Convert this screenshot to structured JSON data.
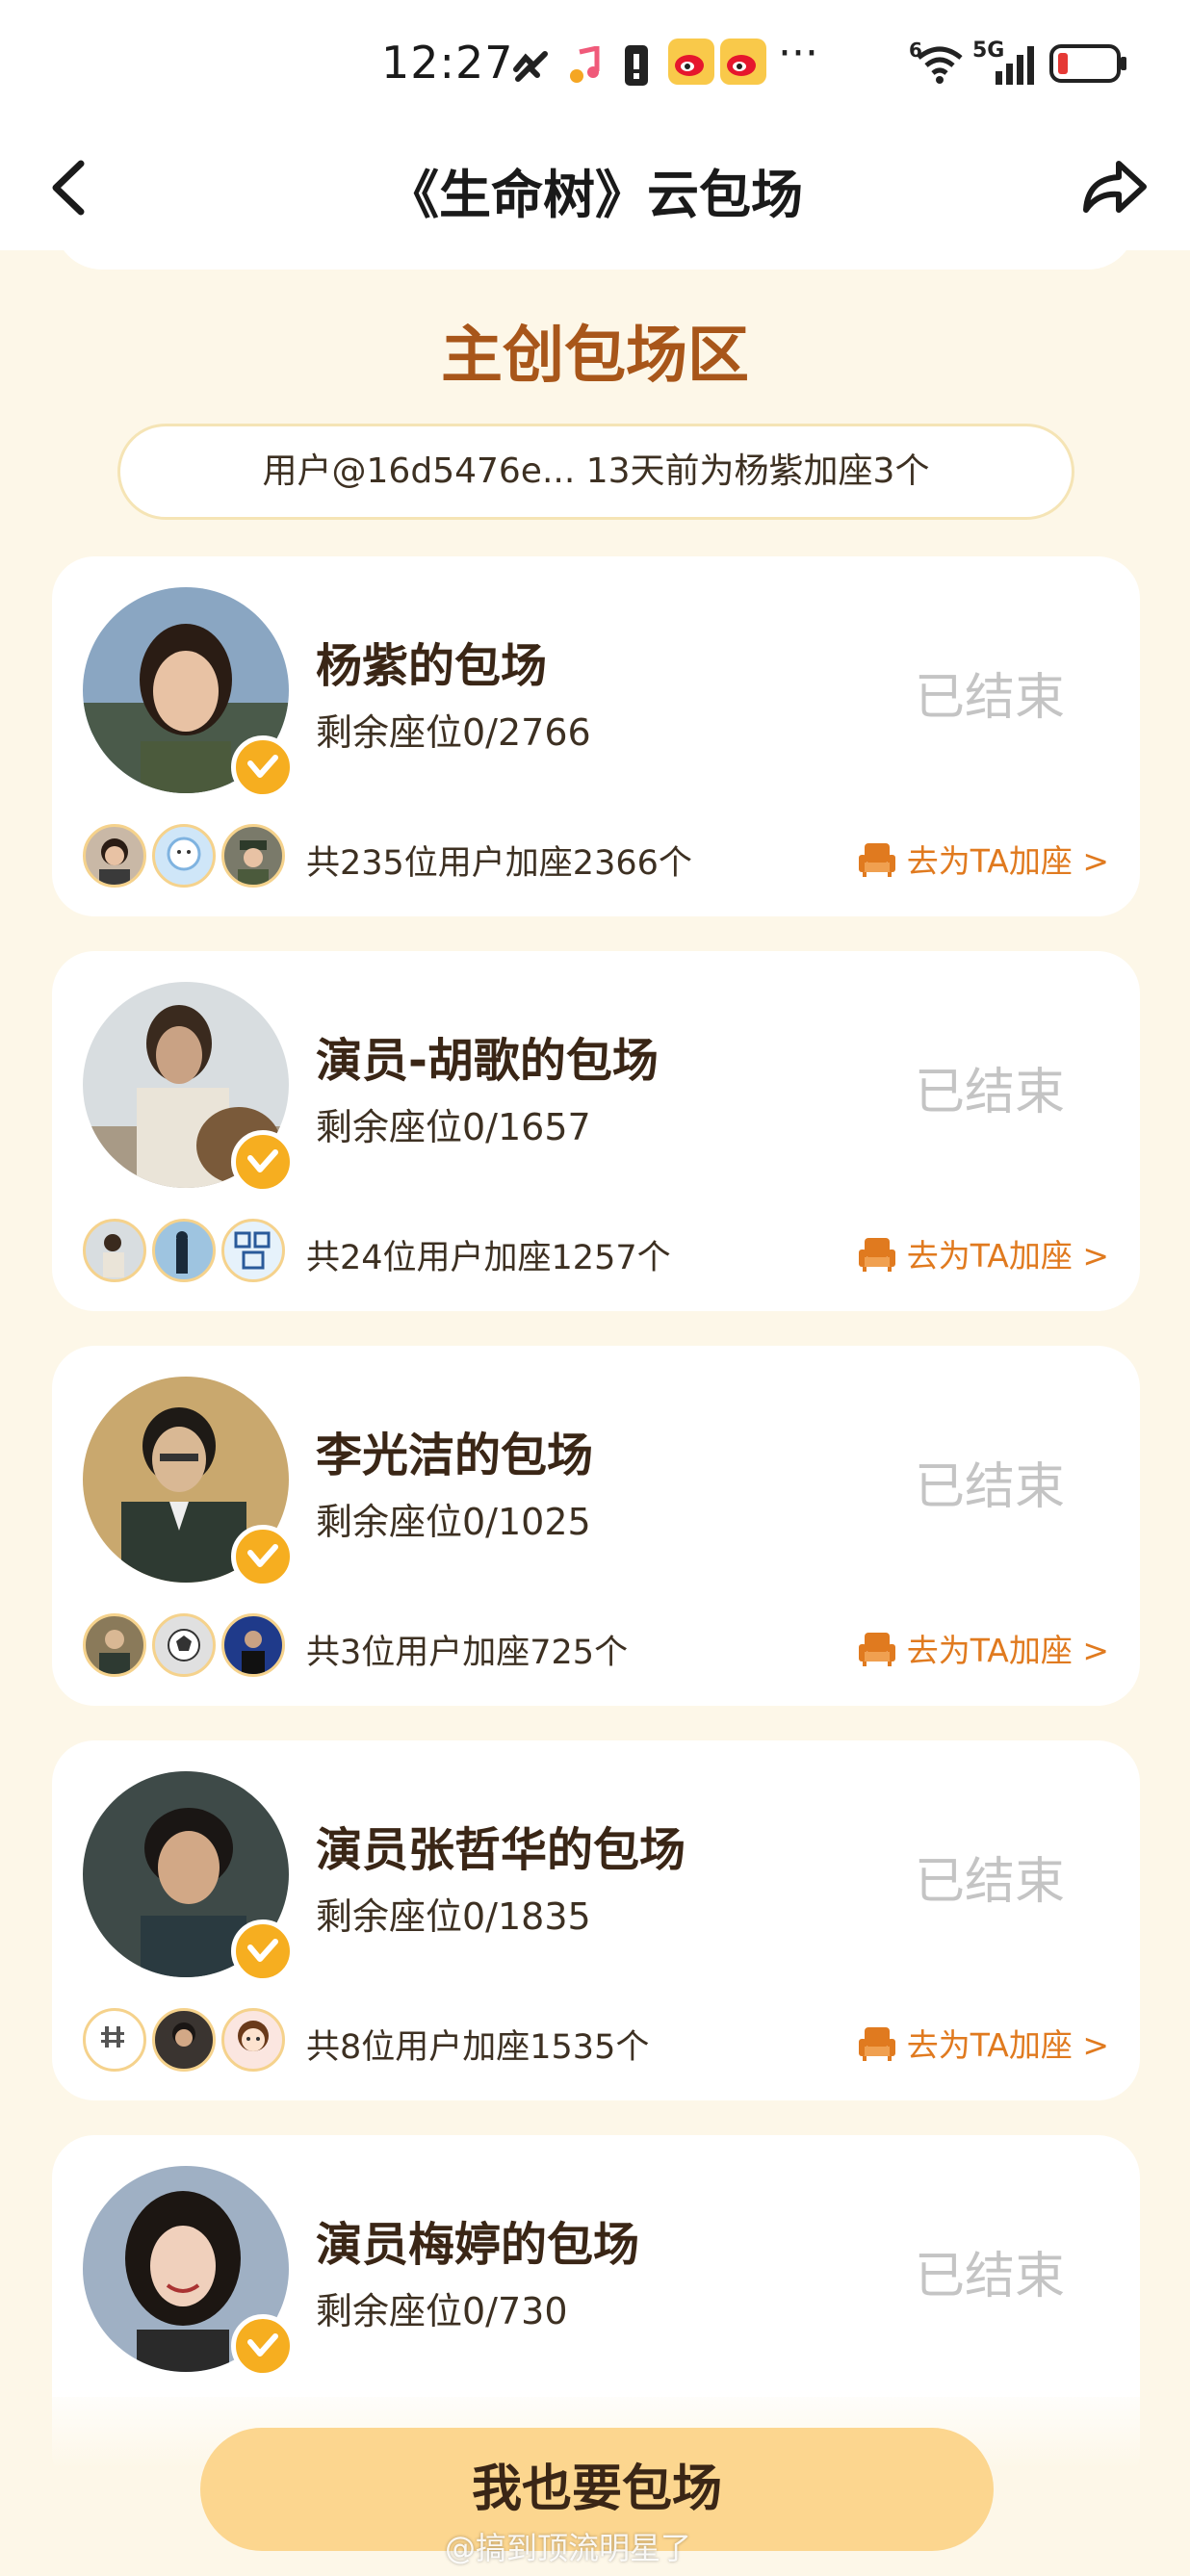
{
  "status_bar": {
    "time": "12:27",
    "more": "···",
    "network": "5G",
    "wifi_badge": "6"
  },
  "nav": {
    "title": "《生命树》云包场"
  },
  "section": {
    "title": "主创包场区",
    "notice": "用户@16d5476e... 13天前为杨紫加座3个"
  },
  "cards": [
    {
      "name": "杨紫的包场",
      "seats": "剩余座位0/2766",
      "status": "已结束",
      "users": "共235位用户加座2366个",
      "link": "去为TA加座 >"
    },
    {
      "name": "演员-胡歌的包场",
      "seats": "剩余座位0/1657",
      "status": "已结束",
      "users": "共24位用户加座1257个",
      "link": "去为TA加座 >"
    },
    {
      "name": "李光洁的包场",
      "seats": "剩余座位0/1025",
      "status": "已结束",
      "users": "共3位用户加座725个",
      "link": "去为TA加座 >"
    },
    {
      "name": "演员张哲华的包场",
      "seats": "剩余座位0/1835",
      "status": "已结束",
      "users": "共8位用户加座1535个",
      "link": "去为TA加座 >"
    },
    {
      "name": "演员梅婷的包场",
      "seats": "剩余座位0/730",
      "status": "已结束"
    }
  ],
  "bottom": {
    "cta": "我也要包场",
    "watermark": "@搞到顶流明星了"
  },
  "colors": {
    "page_bg": "#fdf7e8",
    "accent_orange": "#e07a1f",
    "title_brown": "#a8561a",
    "cta_bg": "#fcd68f",
    "badge_gold": "#f6ae20",
    "ended_gray": "#c4c4c4"
  },
  "icons": [
    "back-arrow-icon",
    "share-icon",
    "verified-badge-icon",
    "seat-icon",
    "wifi-icon",
    "signal-icon",
    "battery-icon",
    "weibo-icon",
    "music-icon"
  ]
}
